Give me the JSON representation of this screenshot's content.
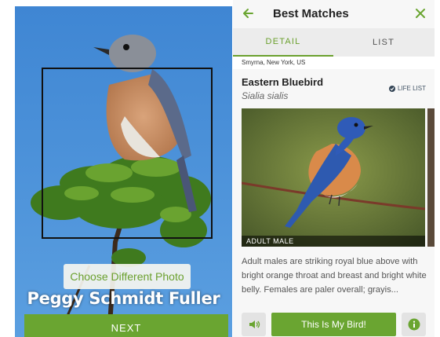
{
  "left_screen": {
    "choose_photo_label": "Choose Different Photo",
    "photographer": "Peggy Schmidt Fuller",
    "next_label": "NEXT"
  },
  "right_screen": {
    "header": {
      "back_icon": "arrow-left-icon",
      "title": "Best Matches",
      "close_icon": "close-icon"
    },
    "tabs": [
      {
        "label": "DETAIL",
        "active": true
      },
      {
        "label": "LIST",
        "active": false
      }
    ],
    "location": "Smyrna, New York, US",
    "species": {
      "common_name": "Eastern Bluebird",
      "scientific_name": "Sialia sialis",
      "life_list_label": "LIFE LIST",
      "photo_caption": "ADULT MALE",
      "description": "Adult males are striking royal blue above with bright orange throat and breast and bright white belly. Females are paler overall; grayis..."
    },
    "actions": {
      "sound_icon": "speaker-icon",
      "confirm_label": "This Is My Bird!",
      "info_icon": "info-icon"
    }
  },
  "colors": {
    "accent_green": "#6aa531",
    "tab_active": "#6ba02e",
    "sky_blue": "#4a8fd6"
  }
}
